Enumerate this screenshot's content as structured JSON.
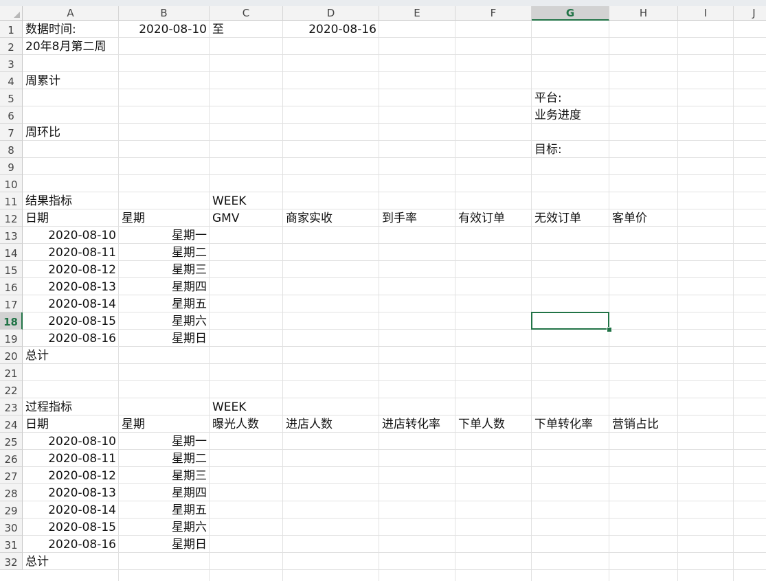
{
  "columns": [
    "A",
    "B",
    "C",
    "D",
    "E",
    "F",
    "G",
    "H",
    "I",
    "J"
  ],
  "rows": [
    "1",
    "2",
    "3",
    "4",
    "5",
    "6",
    "7",
    "8",
    "9",
    "10",
    "11",
    "12",
    "13",
    "14",
    "15",
    "16",
    "17",
    "18",
    "19",
    "20",
    "21",
    "22",
    "23",
    "24",
    "25",
    "26",
    "27",
    "28",
    "29",
    "30",
    "31",
    "32"
  ],
  "selected": {
    "column": "G",
    "row": "18"
  },
  "cells": {
    "A1": "数据时间:",
    "B1": "2020-08-10",
    "C1": "至",
    "D1": "2020-08-16",
    "A2": "20年8月第二周",
    "A4": "周累计",
    "G5": "平台:",
    "G6": "业务进度",
    "A7": "周环比",
    "G8": "目标:",
    "A11": "结果指标",
    "C11": "WEEK",
    "A12": "日期",
    "B12": "星期",
    "C12": "GMV",
    "D12": "商家实收",
    "E12": "到手率",
    "F12": "有效订单",
    "G12": "无效订单",
    "H12": "客单价",
    "A13": "2020-08-10",
    "B13": "星期一",
    "A14": "2020-08-11",
    "B14": "星期二",
    "A15": "2020-08-12",
    "B15": "星期三",
    "A16": "2020-08-13",
    "B16": "星期四",
    "A17": "2020-08-14",
    "B17": "星期五",
    "A18": "2020-08-15",
    "B18": "星期六",
    "A19": "2020-08-16",
    "B19": "星期日",
    "A20": "总计",
    "A23": "过程指标",
    "C23": "WEEK",
    "A24": "日期",
    "B24": "星期",
    "C24": "曝光人数",
    "D24": "进店人数",
    "E24": "进店转化率",
    "F24": "下单人数",
    "G24": "下单转化率",
    "H24": "营销占比",
    "A25": "2020-08-10",
    "B25": "星期一",
    "A26": "2020-08-11",
    "B26": "星期二",
    "A27": "2020-08-12",
    "B27": "星期三",
    "A28": "2020-08-13",
    "B28": "星期四",
    "A29": "2020-08-14",
    "B29": "星期五",
    "A30": "2020-08-15",
    "B30": "星期六",
    "A31": "2020-08-16",
    "B31": "星期日",
    "A32": "总计"
  }
}
